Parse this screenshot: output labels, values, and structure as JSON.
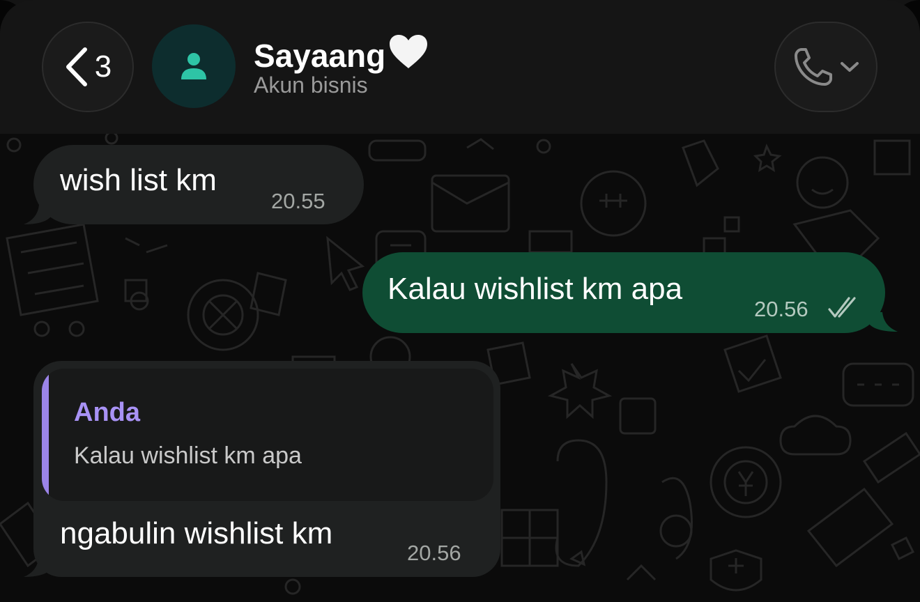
{
  "header": {
    "back_count": "3",
    "contact_name": "Sayaang",
    "contact_subtitle": "Akun bisnis"
  },
  "messages": [
    {
      "direction": "incoming",
      "text": "wish list km",
      "time": "20.55"
    },
    {
      "direction": "outgoing",
      "text": "Kalau wishlist km apa",
      "time": "20.56",
      "status": "read"
    },
    {
      "direction": "incoming",
      "text": "ngabulin wishlist km",
      "time": "20.56",
      "reply_to": {
        "author": "Anda",
        "text": "Kalau wishlist km apa"
      }
    }
  ],
  "colors": {
    "background": "#0b0b0b",
    "header": "#151515",
    "incoming_bubble": "#1f2121",
    "outgoing_bubble": "#0f4d34",
    "avatar_bg": "#0d2d2e",
    "avatar_icon": "#2ec4a6",
    "quote_accent": "#9b84e8",
    "read_ticks": "#b4c9bf"
  },
  "icons": {
    "back": "chevron-left-icon",
    "avatar": "person-icon",
    "heart": "white-heart-emoji",
    "call": "phone-icon",
    "call_menu": "chevron-down-icon",
    "status": "double-check-icon"
  }
}
